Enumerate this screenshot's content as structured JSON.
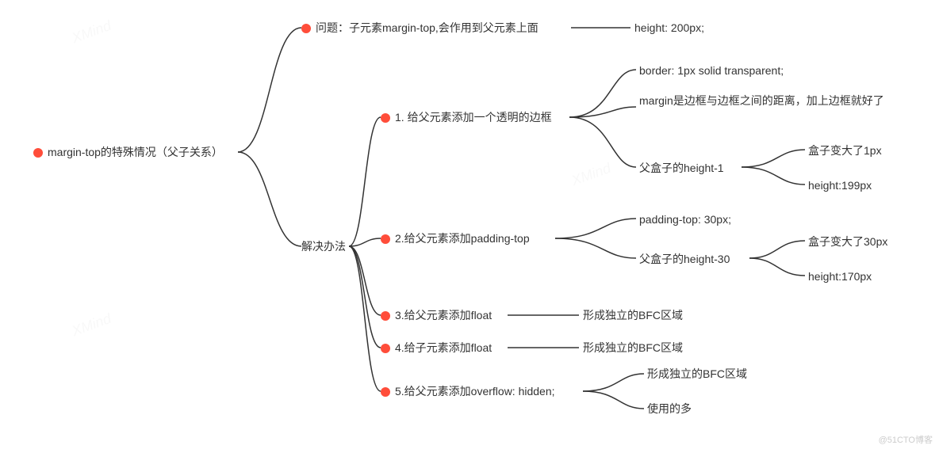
{
  "root": {
    "label": "margin-top的特殊情况（父子关系）"
  },
  "problem": {
    "label": "问题：子元素margin-top,会作用到父元素上面",
    "detail": "height: 200px;"
  },
  "solutions": {
    "title": "解决办法",
    "items": [
      {
        "label": "1. 给父元素添加一个透明的边框",
        "children": [
          {
            "label": "border: 1px solid transparent;"
          },
          {
            "label": "margin是边框与边框之间的距离，加上边框就好了"
          },
          {
            "label": "父盒子的height-1",
            "children": [
              {
                "label": "盒子变大了1px"
              },
              {
                "label": "height:199px"
              }
            ]
          }
        ]
      },
      {
        "label": "2.给父元素添加padding-top",
        "children": [
          {
            "label": "padding-top: 30px;"
          },
          {
            "label": "父盒子的height-30",
            "children": [
              {
                "label": "盒子变大了30px"
              },
              {
                "label": "height:170px"
              }
            ]
          }
        ]
      },
      {
        "label": "3.给父元素添加float",
        "children": [
          {
            "label": "形成独立的BFC区域"
          }
        ]
      },
      {
        "label": "4.给子元素添加float",
        "children": [
          {
            "label": "形成独立的BFC区域"
          }
        ]
      },
      {
        "label": "5.给父元素添加overflow: hidden;",
        "children": [
          {
            "label": "形成独立的BFC区域"
          },
          {
            "label": "使用的多"
          }
        ]
      }
    ]
  },
  "watermark": "XMind",
  "footer": "@51CTO博客"
}
